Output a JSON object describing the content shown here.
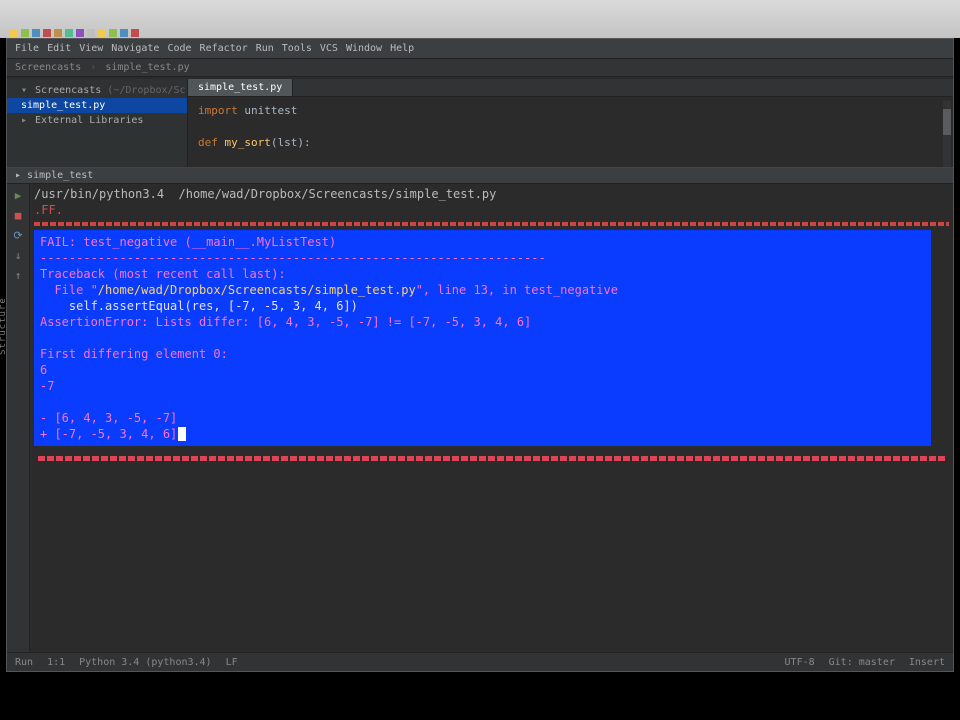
{
  "menu": {
    "items": [
      "File",
      "Edit",
      "View",
      "Navigate",
      "Code",
      "Refactor",
      "Run",
      "Tools",
      "VCS",
      "Window",
      "Help"
    ]
  },
  "breadcrumb": {
    "parts": [
      "Screencasts",
      "simple_test.py"
    ]
  },
  "project": {
    "root": "Screencasts",
    "root_hint": "(~/Dropbox/Screencasts)",
    "file": "simple_test.py",
    "ext_lib": "External Libraries"
  },
  "tabs": {
    "t1": "simple_test.py"
  },
  "code": {
    "l1_kw": "import",
    "l1_mod": " unittest",
    "l3_kw": "def ",
    "l3_fn": "my_sort",
    "l3_rest": "(lst):"
  },
  "run": {
    "tab_label": "simple_test",
    "command": "/usr/bin/python3.4  /home/wad/Dropbox/Screencasts/simple_test.py",
    "progress": ".FF.",
    "sel": {
      "fail_header": "FAIL: test_negative (__main__.MyListTest)",
      "dashline": "----------------------------------------------------------------------",
      "trace_head": "Traceback (most recent call last):",
      "trace_file_pre": "  File \"",
      "trace_file_path": "/home/wad/Dropbox/Screencasts/simple_test.py",
      "trace_file_post": "\", line 13, in test_negative",
      "trace_code": "    self.assertEqual(res, [-7, -5, 3, 4, 6])",
      "assert_err": "AssertionError: Lists differ: [6, 4, 3, -5, -7] != [-7, -5, 3, 4, 6]",
      "first_diff": "First differing element 0:",
      "a0": "6",
      "b0": "-7",
      "listA": "- [6, 4, 3, -5, -7]",
      "listB": "+ [-7, -5, 3, 4, 6]"
    }
  },
  "status": {
    "col": "1:1",
    "insert": "Insert",
    "python": "Python 3.4 (python3.4)",
    "run": "Run",
    "lf": "LF",
    "enc": "UTF-8",
    "git": "Git: master"
  },
  "vlabel": "Structure"
}
